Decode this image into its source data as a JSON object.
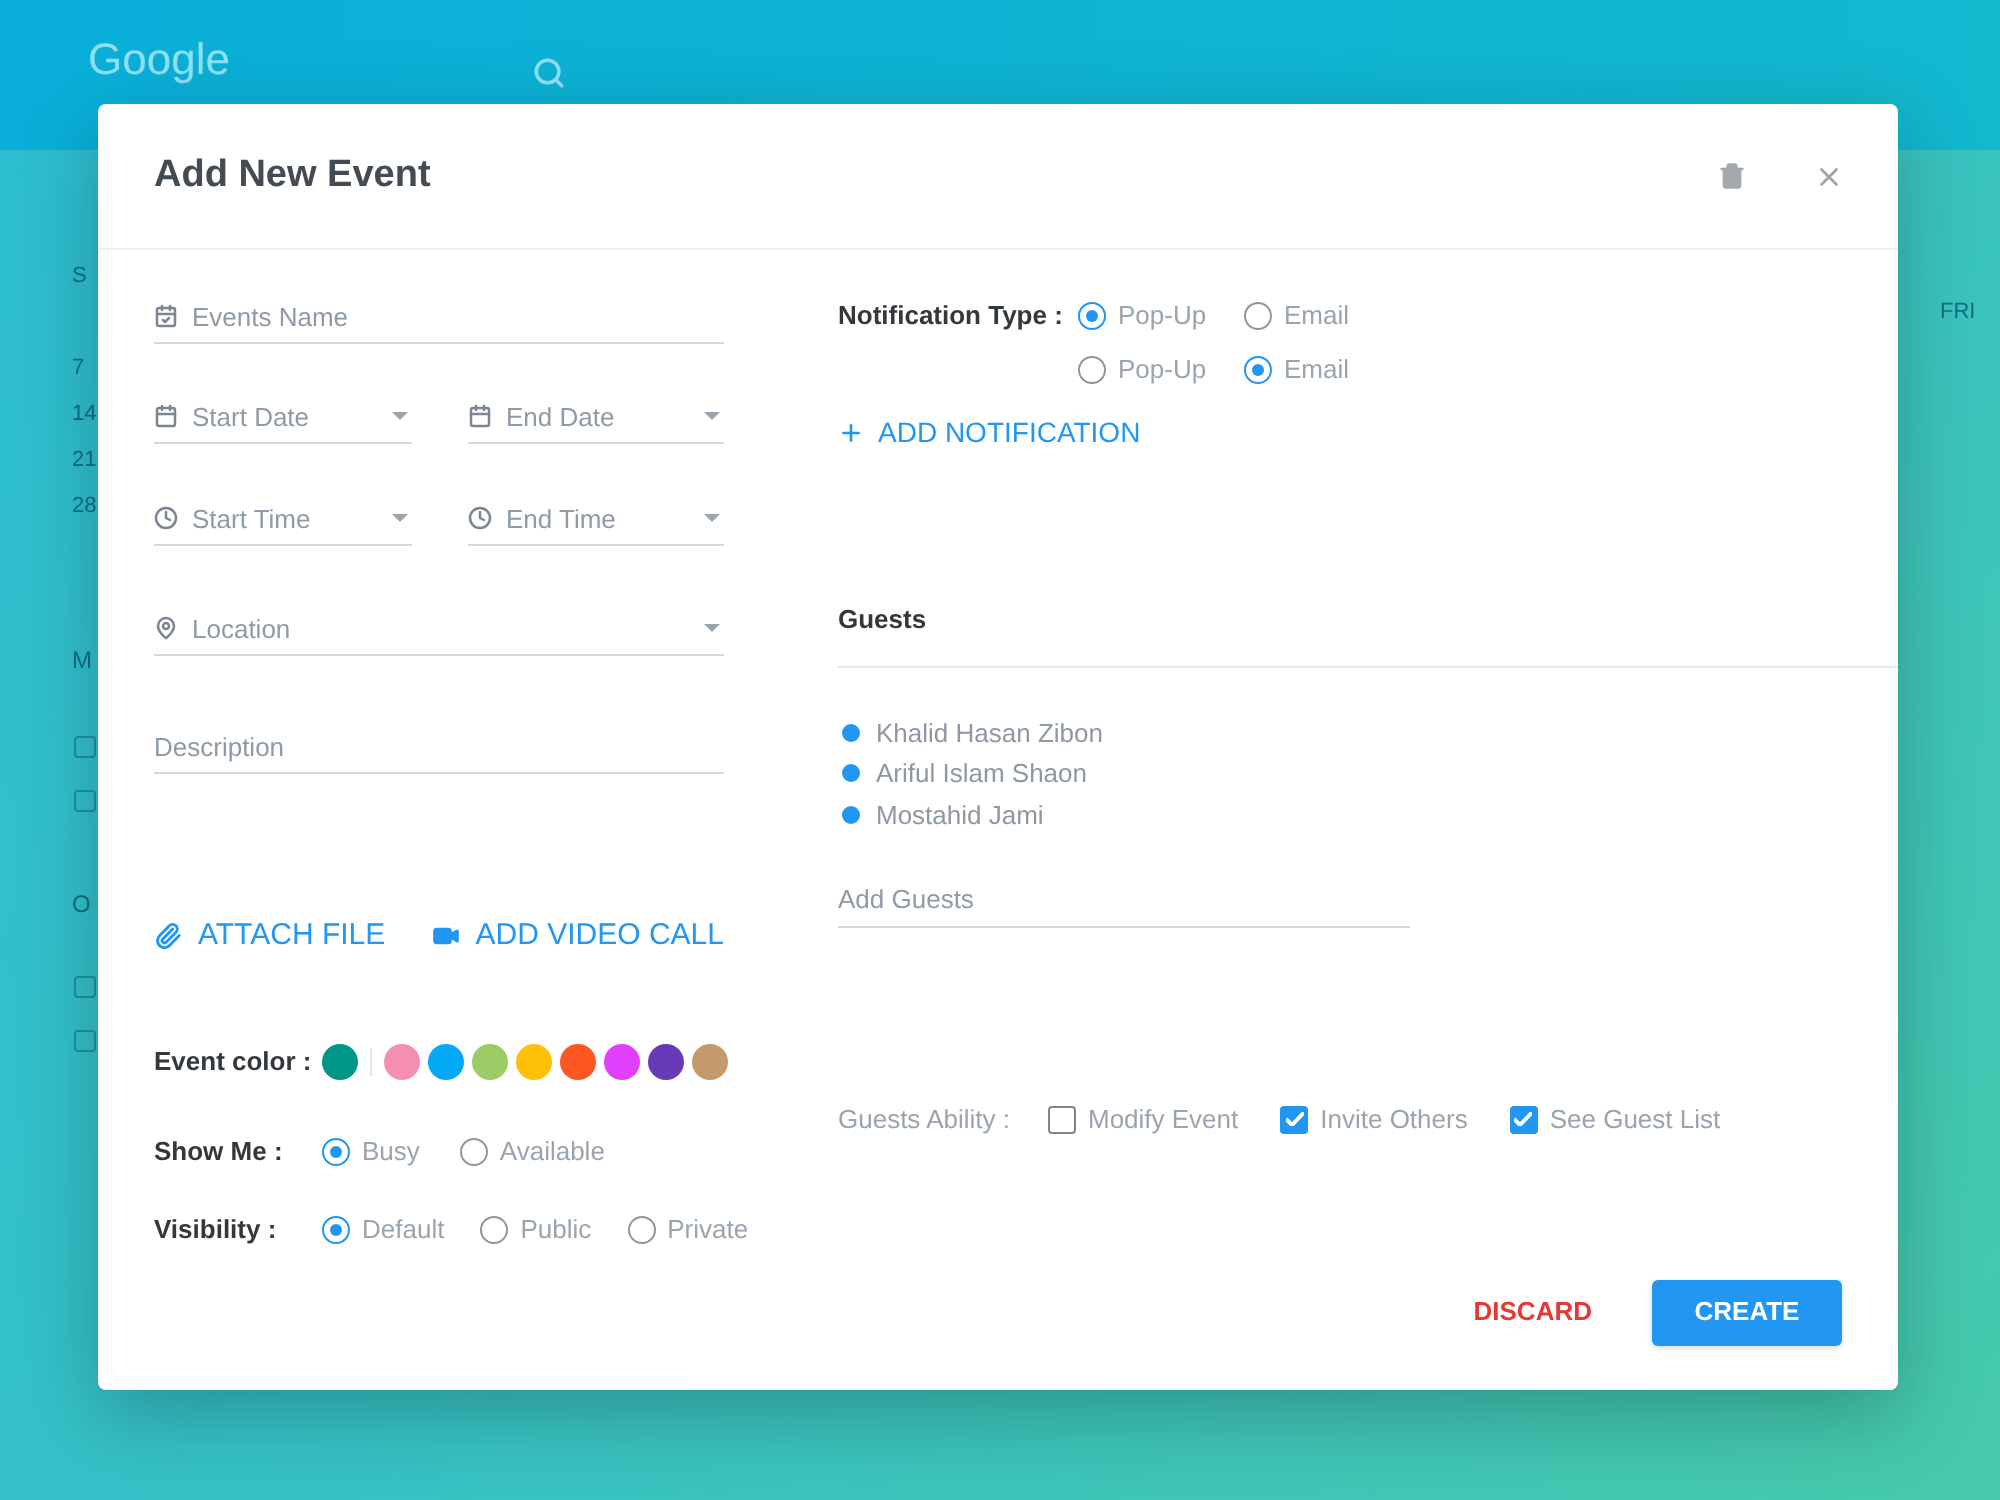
{
  "backdrop": {
    "app_name": "Google",
    "day_label": "FRI",
    "mini_calendar": [
      "S",
      "7",
      "14",
      "21",
      "28"
    ],
    "calendar_groups": [
      {
        "label": "M",
        "items": [
          {
            "checked": false
          },
          {
            "checked": false
          }
        ]
      },
      {
        "label": "O",
        "items": [
          {
            "checked": false
          },
          {
            "checked": false
          }
        ]
      }
    ]
  },
  "dialog": {
    "title": "Add New Event",
    "event_name": {
      "placeholder": "Events Name"
    },
    "dates": [
      {
        "placeholder": "Start Date"
      },
      {
        "placeholder": "End Date"
      }
    ],
    "times": [
      {
        "placeholder": "Start Time"
      },
      {
        "placeholder": "End Time"
      }
    ],
    "location": {
      "placeholder": "Location"
    },
    "description": {
      "placeholder": "Description"
    },
    "attachments": [
      {
        "kind": "file",
        "label": "ATTACH FILE"
      },
      {
        "kind": "video",
        "label": "ADD VIDEO CALL"
      }
    ],
    "event_color": {
      "label": "Event color :",
      "current": {
        "color": "#009688"
      },
      "palette": [
        {
          "color": "#f48fb1"
        },
        {
          "color": "#03a9f4"
        },
        {
          "color": "#9ccc65"
        },
        {
          "color": "#ffc107"
        },
        {
          "color": "#ff5722"
        },
        {
          "color": "#e040fb"
        },
        {
          "color": "#673ab7"
        },
        {
          "color": "#c49a6c"
        }
      ]
    },
    "show_me": {
      "label": "Show Me :",
      "options": [
        {
          "label": "Busy",
          "selected": true
        },
        {
          "label": "Available",
          "selected": false
        }
      ]
    },
    "visibility": {
      "label": "Visibility :",
      "options": [
        {
          "label": "Default",
          "selected": true
        },
        {
          "label": "Public",
          "selected": false
        },
        {
          "label": "Private",
          "selected": false
        }
      ]
    },
    "notification": {
      "label": "Notification Type :",
      "rows": [
        {
          "options": [
            {
              "label": "Pop-Up",
              "selected": true
            },
            {
              "label": "Email",
              "selected": false
            }
          ]
        },
        {
          "options": [
            {
              "label": "Pop-Up",
              "selected": false
            },
            {
              "label": "Email",
              "selected": true
            }
          ]
        }
      ],
      "add_label": "ADD NOTIFICATION"
    },
    "guests": {
      "title": "Guests",
      "names": [
        "Khalid Hasan Zibon",
        "Ariful Islam Shaon",
        "Mostahid Jami"
      ],
      "add_guests": {
        "placeholder": "Add Guests"
      },
      "ability": {
        "label": "Guests Ability :",
        "options": [
          {
            "label": "Modify Event",
            "checked": false
          },
          {
            "label": "Invite Others",
            "checked": true
          },
          {
            "label": "See Guest List",
            "checked": true
          }
        ]
      }
    },
    "buttons": [
      {
        "kind": "text",
        "label": "DISCARD"
      },
      {
        "kind": "primary",
        "label": "CREATE"
      }
    ]
  }
}
